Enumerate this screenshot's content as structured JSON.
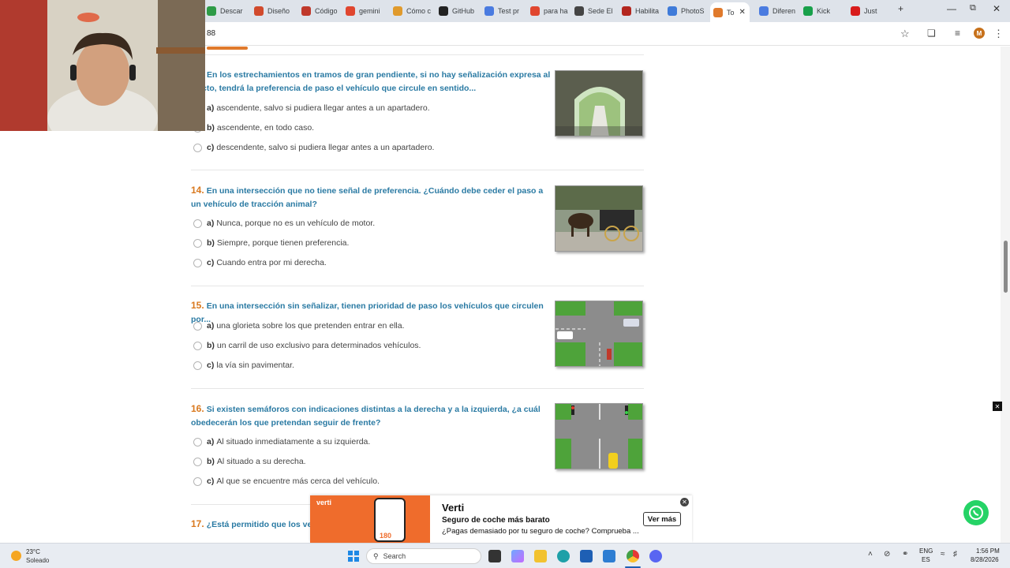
{
  "browser": {
    "tabs": [
      {
        "label": "Descar",
        "color": "#2e9b47"
      },
      {
        "label": "Diseño",
        "color": "#d14a2c"
      },
      {
        "label": "Código",
        "color": "#c0392b"
      },
      {
        "label": "gemini",
        "color": "#e0462f"
      },
      {
        "label": "Cómo c",
        "color": "#e09a2c"
      },
      {
        "label": "GitHub",
        "color": "#222222"
      },
      {
        "label": "Test pr",
        "color": "#4a7be0"
      },
      {
        "label": "para ha",
        "color": "#e0462f"
      },
      {
        "label": "Sede El",
        "color": "#444444"
      },
      {
        "label": "Habilita",
        "color": "#b3261e"
      },
      {
        "label": "PhotoS",
        "color": "#3f7bd9"
      },
      {
        "label": "To",
        "color": "#e07a2c"
      },
      {
        "label": "Diferen",
        "color": "#4a7be0"
      },
      {
        "label": "Kick",
        "color": "#18a04a"
      },
      {
        "label": "Just",
        "color": "#d81b1b"
      }
    ],
    "new_tab": "+",
    "url": "88",
    "avatar_letter": "M"
  },
  "quiz": {
    "q13": {
      "text": "En los estrechamientos en tramos de gran pendiente, si no hay señalización expresa al efecto, tendrá la preferencia de paso el vehículo que circule en sentido...",
      "line1": "En los estrechamientos en tramos de gran pendiente, si no hay señalización expresa al",
      "line2": "cto, tendrá la preferencia de paso el vehículo que circule en sentido...",
      "options": [
        {
          "letter": "a)",
          "text": "ascendente, salvo si pudiera llegar antes a un apartadero."
        },
        {
          "letter": "b)",
          "text": "ascendente, en todo caso."
        },
        {
          "letter": "c)",
          "text": "descendente, salvo si pudiera llegar antes a un apartadero."
        }
      ]
    },
    "q14": {
      "num": "14.",
      "text": "En una intersección que no tiene señal de preferencia. ¿Cuándo debe ceder el paso a un vehículo de tracción animal?",
      "options": [
        {
          "letter": "a)",
          "text": "Nunca, porque no es un vehículo de motor."
        },
        {
          "letter": "b)",
          "text": "Siempre, porque tienen preferencia."
        },
        {
          "letter": "c)",
          "text": "Cuando entra por mi derecha."
        }
      ]
    },
    "q15": {
      "num": "15.",
      "text": "En una intersección sin señalizar, tienen prioridad de paso los vehículos que circulen por...",
      "options": [
        {
          "letter": "a)",
          "text": "una glorieta sobre los que pretenden entrar en ella."
        },
        {
          "letter": "b)",
          "text": "un carril de uso exclusivo para determinados vehículos."
        },
        {
          "letter": "c)",
          "text": "la vía sin pavimentar."
        }
      ]
    },
    "q16": {
      "num": "16.",
      "text": "Si existen semáforos con indicaciones distintas a la derecha y a la izquierda, ¿a cuál obedecerán los que pretendan seguir de frente?",
      "options": [
        {
          "letter": "a)",
          "text": "Al situado inmediatamente a su izquierda."
        },
        {
          "letter": "b)",
          "text": "Al situado a su derecha."
        },
        {
          "letter": "c)",
          "text": "Al que se encuentre más cerca del vehículo."
        }
      ]
    },
    "q17": {
      "num": "17.",
      "text": "¿Está permitido que los veh"
    }
  },
  "ad": {
    "brand": "Verti",
    "subtitle": "Seguro de coche más barato",
    "description": "¿Pagas demasiado por tu seguro de coche? Comprueba ...",
    "cta": "Ver más",
    "image_brand": "verti",
    "image_text": "180"
  },
  "taskbar": {
    "weather_temp": "23°C",
    "weather_desc": "Soleado",
    "search_placeholder": "Search",
    "lang": "ENG",
    "lang_sub": "ES",
    "time": "1:56 PM",
    "date": "8/28/2026"
  }
}
